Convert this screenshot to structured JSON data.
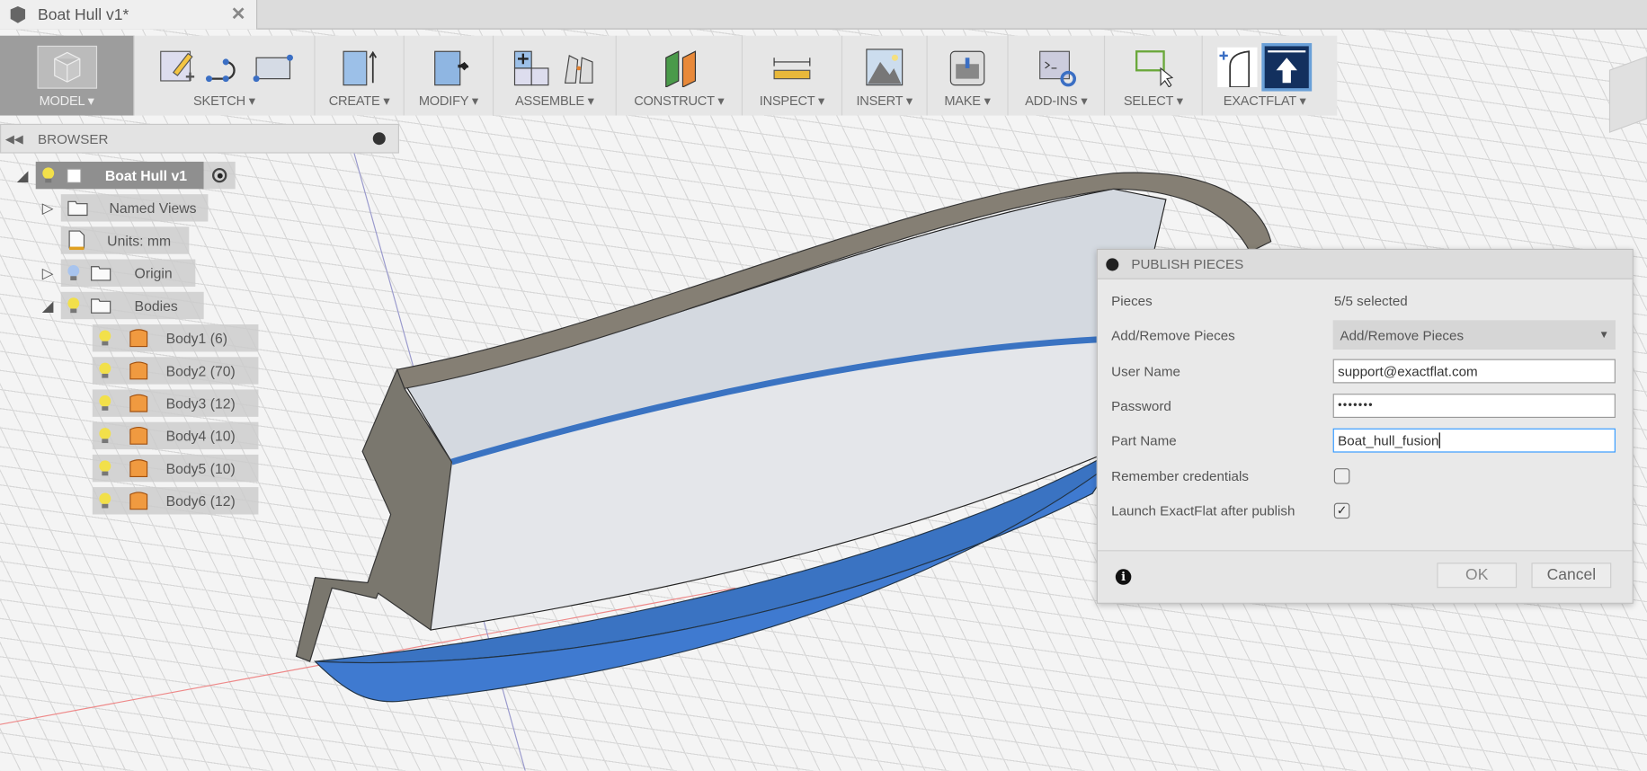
{
  "document_tab": {
    "title": "Boat Hull v1*",
    "close": "✕"
  },
  "toolbar": {
    "model": "MODEL ▾",
    "sketch": "SKETCH ▾",
    "create": "CREATE ▾",
    "modify": "MODIFY ▾",
    "assemble": "ASSEMBLE ▾",
    "construct": "CONSTRUCT ▾",
    "inspect": "INSPECT ▾",
    "insert": "INSERT ▾",
    "make": "MAKE ▾",
    "addins": "ADD-INS ▾",
    "select": "SELECT ▾",
    "exactflat": "EXACTFLAT ▾"
  },
  "browser": {
    "title": "BROWSER",
    "root": "Boat Hull v1",
    "named_views": "Named Views",
    "units": "Units: mm",
    "origin": "Origin",
    "bodies": "Bodies",
    "body_items": [
      "Body1 (6)",
      "Body2 (70)",
      "Body3 (12)",
      "Body4 (10)",
      "Body5 (10)",
      "Body6 (12)"
    ]
  },
  "dialog": {
    "title": "PUBLISH PIECES",
    "pieces_label": "Pieces",
    "pieces_value": "5/5 selected",
    "addremove_label": "Add/Remove Pieces",
    "addremove_value": "Add/Remove Pieces",
    "username_label": "User Name",
    "username_value": "support@exactflat.com",
    "password_label": "Password",
    "password_value": "•••••••",
    "partname_label": "Part Name",
    "partname_value": "Boat_hull_fusion",
    "remember_label": "Remember credentials",
    "remember_checked": false,
    "launch_label": "Launch ExactFlat after publish",
    "launch_checked": true,
    "ok": "OK",
    "cancel": "Cancel"
  },
  "colors": {
    "hull_blue": "#3a73c2",
    "hull_gray": "#7a776e",
    "accent": "#3399ff"
  }
}
